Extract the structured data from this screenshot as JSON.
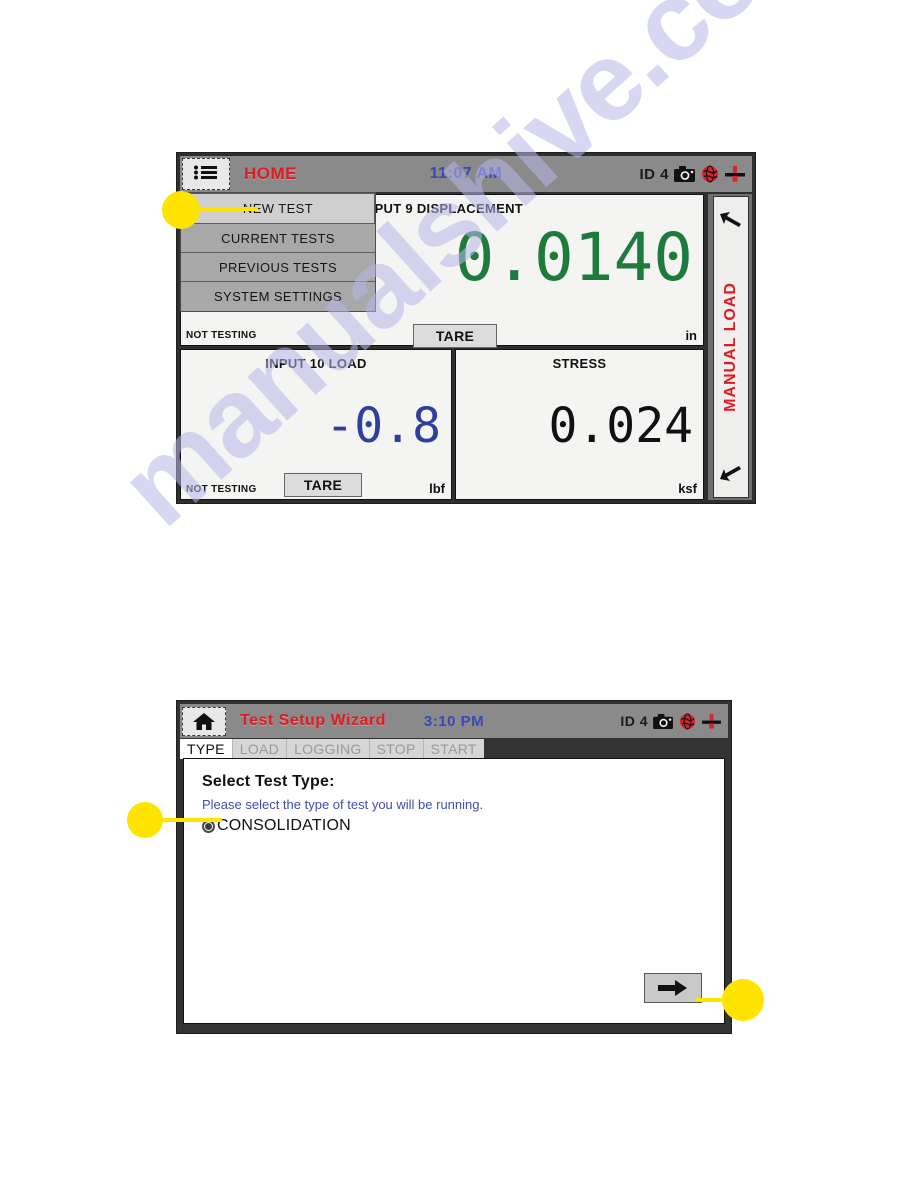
{
  "watermark": {
    "text": "manualshive.com"
  },
  "screenshot_home": {
    "titlebar": {
      "menu_icon": "list-menu-icon",
      "title": "HOME",
      "clock": "11:07 AM",
      "id_label": "ID 4",
      "icons": [
        "camera-icon",
        "globe-icon",
        "transducer-icon"
      ]
    },
    "dropdown_menu": {
      "items": [
        {
          "label": "NEW TEST",
          "selected": true
        },
        {
          "label": "CURRENT TESTS",
          "selected": false
        },
        {
          "label": "PREVIOUS TESTS",
          "selected": false
        },
        {
          "label": "SYSTEM SETTINGS",
          "selected": false
        }
      ]
    },
    "panels": [
      {
        "title": "INPUT 9 DISPLACEMENT",
        "value": "0.0140",
        "unit": "in",
        "status": "NOT TESTING",
        "tare_label": "TARE",
        "value_color": "#1f7a3d"
      },
      {
        "title": "INPUT 10 LOAD",
        "value": "-0.8",
        "unit": "lbf",
        "status": "NOT TESTING",
        "tare_label": "TARE",
        "value_color": "#2e3f9e"
      },
      {
        "title": "STRESS",
        "value": "0.024",
        "unit": "ksf",
        "status": "",
        "tare_label": "",
        "value_color": "#111111"
      }
    ],
    "rail": {
      "label": "MANUAL LOAD",
      "up_icon": "arrow-up-left-icon",
      "down_icon": "arrow-down-left-icon",
      "label_color": "#e01b22"
    }
  },
  "screenshot_wizard": {
    "titlebar": {
      "home_icon": "home-icon",
      "title": "Test Setup Wizard",
      "clock": "3:10 PM",
      "id_label": "ID 4",
      "icons": [
        "camera-icon",
        "globe-icon",
        "transducer-icon"
      ]
    },
    "tabs": [
      {
        "label": "TYPE",
        "active": true
      },
      {
        "label": "LOAD",
        "active": false
      },
      {
        "label": "LOGGING",
        "active": false
      },
      {
        "label": "STOP",
        "active": false
      },
      {
        "label": "START",
        "active": false
      }
    ],
    "content": {
      "heading": "Select Test Type:",
      "subtext": "Please select the type of test you will be running.",
      "options": [
        {
          "label": "CONSOLIDATION",
          "selected": true
        }
      ]
    },
    "next_button": {
      "icon": "arrow-right-icon"
    }
  }
}
